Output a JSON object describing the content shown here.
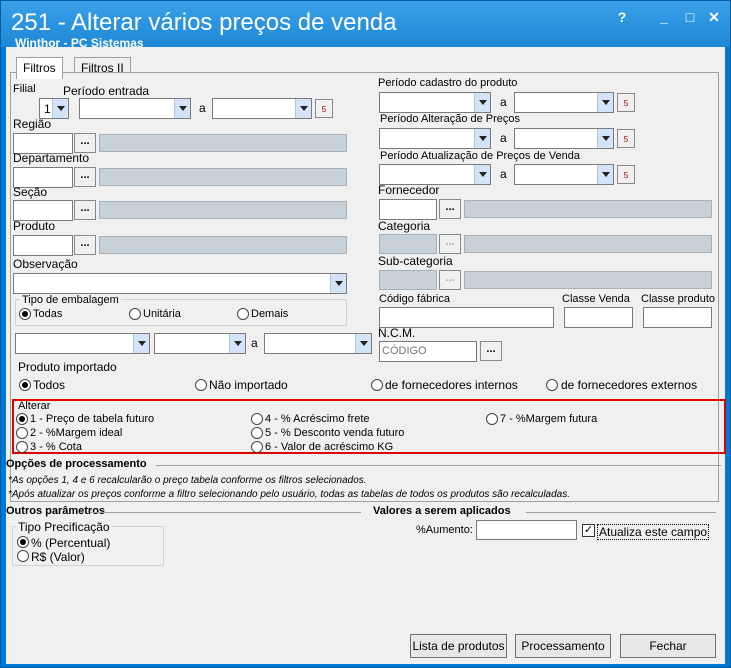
{
  "window": {
    "title": "251 - Alterar vários preços de venda",
    "subtitle": "Winthor - PC Sistemas",
    "help": "?",
    "minimize": "_",
    "maximize": "□",
    "close": "✕"
  },
  "tabs": [
    "Filtros",
    "Filtros II"
  ],
  "filtros": {
    "filial_label": "Filial",
    "filial_value": "1",
    "periodo_entrada": "Período entrada",
    "a": "a",
    "regiao": "Região",
    "departamento": "Departamento",
    "secao": "Seção",
    "produto": "Produto",
    "observacao": "Observação",
    "periodo_cadastro": "Período cadastro do produto",
    "periodo_alteracao": "Período Alteração de Preços",
    "periodo_atualizacao": "Período Atualização de Preços de Venda",
    "fornecedor": "Fornecedor",
    "categoria": "Categoria",
    "subcategoria": "Sub-categoria",
    "codigo_fabrica": "Código fábrica",
    "classe_venda": "Classe Venda",
    "classe_produto": "Classe produto",
    "ncm": "N.C.M.",
    "ncm_placeholder": "CÓDIGO",
    "dots": "...",
    "tipo_embalagem": "Tipo de embalagem",
    "emb_todas": "Todas",
    "emb_unitaria": "Unitária",
    "emb_demais": "Demais",
    "produto_importado": "Produto importado",
    "imp_todos": "Todos",
    "imp_nao": "Não importado",
    "imp_forn_int": "de fornecedores internos",
    "imp_forn_ext": "de fornecedores externos",
    "alterar": "Alterar",
    "alt1": "1 - Preço de tabela futuro",
    "alt2": "2 - %Margem ideal",
    "alt3": "3 - % Cota",
    "alt4": "4 - % Acréscimo frete",
    "alt5": "5 - % Desconto venda futuro",
    "alt6": "6 - Valor de acréscimo KG",
    "alt7": "7 - %Margem futura"
  },
  "opcoes": {
    "title": "Opções de processamento",
    "note1": "*As opções 1, 4 e 6 recalcularão o preço tabela conforme os filtros selecionados.",
    "note2": "*Após atualizar os preços conforme a filtro selecionando pelo usuário, todas as tabelas de todos os produtos são recalculadas."
  },
  "outros": {
    "title": "Outros parâmetros",
    "tipo": "Tipo Precificação",
    "perc": "% (Percentual)",
    "valor": "R$ (Valor)"
  },
  "valores": {
    "title": "Valores a serem aplicados",
    "aumento": "%Aumento:",
    "atualiza": "Atualiza este campo",
    "check": "✓"
  },
  "buttons": {
    "lista": "Lista de produtos",
    "processamento": "Processamento",
    "fechar": "Fechar"
  }
}
